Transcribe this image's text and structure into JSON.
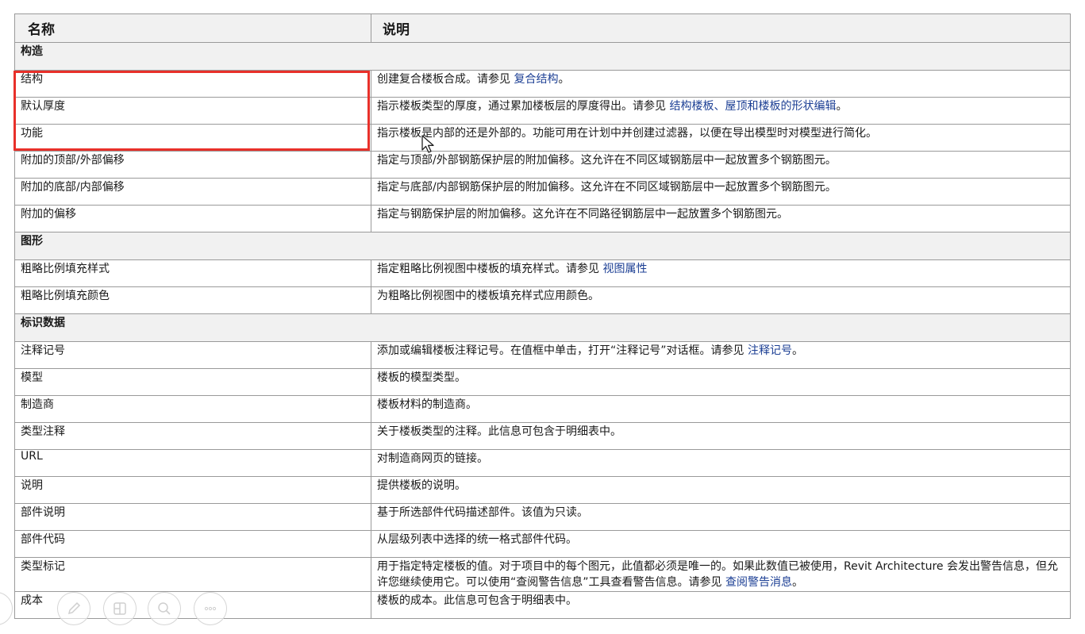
{
  "table": {
    "headers": {
      "name": "名称",
      "description": "说明"
    },
    "sections": [
      {
        "title": "构造",
        "rows": [
          {
            "name": "结构",
            "desc": [
              {
                "t": "创建复合楼板合成。请参见 "
              },
              {
                "t": "复合结构",
                "link": true
              },
              {
                "t": "。"
              }
            ]
          },
          {
            "name": "默认厚度",
            "desc": [
              {
                "t": "指示楼板类型的厚度，通过累加楼板层的厚度得出。请参见 "
              },
              {
                "t": "结构楼板、屋顶和楼板的形状编辑",
                "link": true
              },
              {
                "t": "。"
              }
            ]
          },
          {
            "name": "功能",
            "desc": [
              {
                "t": "指示楼板是内部的还是外部的。功能可用在计划中并创建过滤器，以便在导出模型时对模型进行简化。"
              }
            ]
          },
          {
            "name": "附加的顶部/外部偏移",
            "desc": [
              {
                "t": "指定与顶部/外部钢筋保护层的附加偏移。这允许在不同区域钢筋层中一起放置多个钢筋图元。"
              }
            ]
          },
          {
            "name": "附加的底部/内部偏移",
            "desc": [
              {
                "t": "指定与底部/内部钢筋保护层的附加偏移。这允许在不同区域钢筋层中一起放置多个钢筋图元。"
              }
            ]
          },
          {
            "name": "附加的偏移",
            "desc": [
              {
                "t": "指定与钢筋保护层的附加偏移。这允许在不同路径钢筋层中一起放置多个钢筋图元。"
              }
            ]
          }
        ]
      },
      {
        "title": "图形",
        "rows": [
          {
            "name": "粗略比例填充样式",
            "desc": [
              {
                "t": "指定粗略比例视图中楼板的填充样式。请参见 "
              },
              {
                "t": "视图属性",
                "link": true
              }
            ]
          },
          {
            "name": "粗略比例填充颜色",
            "desc": [
              {
                "t": "为粗略比例视图中的楼板填充样式应用颜色。"
              }
            ]
          }
        ]
      },
      {
        "title": "标识数据",
        "rows": [
          {
            "name": "注释记号",
            "desc": [
              {
                "t": "添加或编辑楼板注释记号。在值框中单击，打开“注释记号”对话框。请参见 "
              },
              {
                "t": "注释记号",
                "link": true
              },
              {
                "t": "。"
              }
            ]
          },
          {
            "name": "模型",
            "desc": [
              {
                "t": "楼板的模型类型。"
              }
            ]
          },
          {
            "name": "制造商",
            "desc": [
              {
                "t": "楼板材料的制造商。"
              }
            ]
          },
          {
            "name": "类型注释",
            "desc": [
              {
                "t": "关于楼板类型的注释。此信息可包含于明细表中。"
              }
            ]
          },
          {
            "name": "URL",
            "desc": [
              {
                "t": "对制造商网页的链接。"
              }
            ]
          },
          {
            "name": "说明",
            "desc": [
              {
                "t": "提供楼板的说明。"
              }
            ]
          },
          {
            "name": "部件说明",
            "desc": [
              {
                "t": "基于所选部件代码描述部件。该值为只读。"
              }
            ]
          },
          {
            "name": "部件代码",
            "desc": [
              {
                "t": "从层级列表中选择的统一格式部件代码。"
              }
            ]
          },
          {
            "name": "类型标记",
            "tall": true,
            "desc": [
              {
                "t": "用于指定特定楼板的值。对于项目中的每个图元，此值都必须是唯一的。如果此数值已被使用，Revit Architecture 会发出警告信息，但允许您继续使用它。可以使用“查阅警告信息”工具查看警告信息。请参见 "
              },
              {
                "t": "查阅警告消息",
                "link": true
              },
              {
                "t": "。"
              }
            ]
          },
          {
            "name": "成本",
            "desc": [
              {
                "t": "楼板的成本。此信息可包含于明细表中。"
              }
            ]
          }
        ]
      }
    ]
  },
  "colors": {
    "highlight": "#e8302a",
    "link": "#1c3f94",
    "header_bg": "#f1f1f1",
    "border": "#9a9a9a"
  },
  "toolbar": {
    "icons": [
      "arrow-icon",
      "pen-icon",
      "layout-icon",
      "zoom-icon",
      "more-icon"
    ]
  }
}
